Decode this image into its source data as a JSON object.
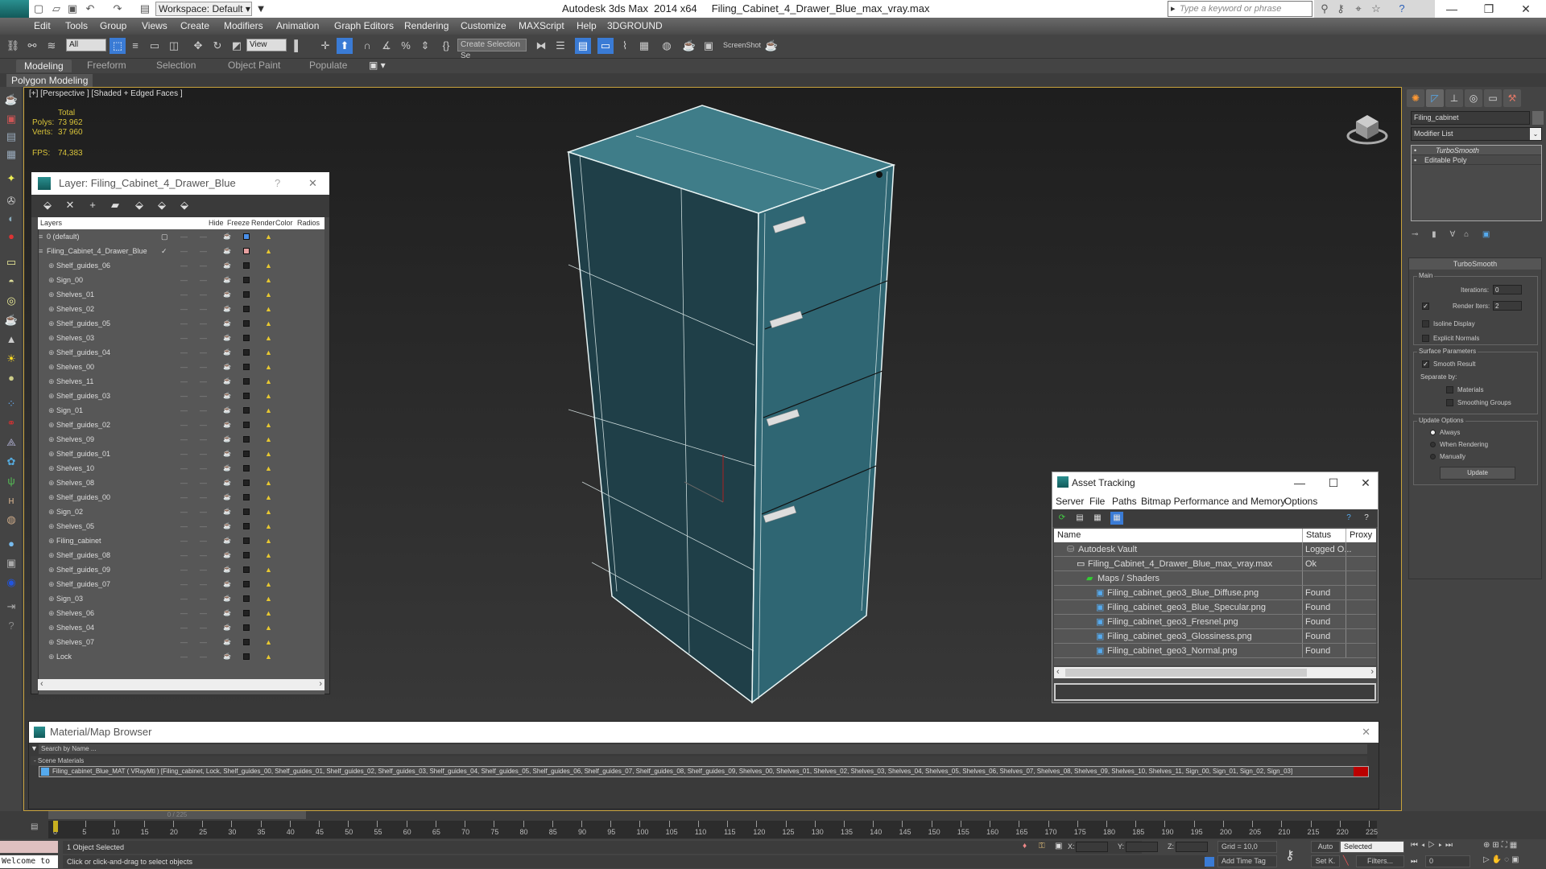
{
  "titlebar": {
    "workspace": "Workspace: Default",
    "app_title": "Autodesk 3ds Max  2014 x64     Filing_Cabinet_4_Drawer_Blue_max_vray.max",
    "search_placeholder": "Type a keyword or phrase"
  },
  "menu": [
    "Edit",
    "Tools",
    "Group",
    "Views",
    "Create",
    "Modifiers",
    "Animation",
    "Graph Editors",
    "Rendering",
    "Customize",
    "MAXScript",
    "Help",
    "3DGROUND"
  ],
  "toolbar": {
    "selection_filter": "All",
    "ref_coord": "View",
    "named_selection": "Create Selection Se",
    "screenshot_label": "ScreenShot"
  },
  "ribbon": {
    "tabs": [
      "Modeling",
      "Freeform",
      "Selection",
      "Object Paint",
      "Populate"
    ],
    "active": "Modeling",
    "sub": "Polygon Modeling"
  },
  "viewport": {
    "label": "[+] [Perspective ] [Shaded + Edged Faces ]",
    "stats": {
      "header": "Total",
      "polys_label": "Polys:",
      "polys": "73 962",
      "verts_label": "Verts:",
      "verts": "37 960",
      "fps_label": "FPS:",
      "fps": "74,383"
    },
    "colors": {
      "cabinet_side": "#1f3f48",
      "cabinet_front": "#2f6673",
      "cabinet_top": "#3f7d89",
      "wire": "#e8f4f4",
      "frame": "#c8a23c"
    }
  },
  "layer_panel": {
    "title": "Layer: Filing_Cabinet_4_Drawer_Blue",
    "columns": [
      "Layers",
      "",
      "Hide",
      "Freeze",
      "Render",
      "Color",
      "Radios"
    ],
    "layers": [
      {
        "name": "0 (default)",
        "type": "layer",
        "color": "#4a8fe8"
      },
      {
        "name": "Filing_Cabinet_4_Drawer_Blue",
        "type": "layer",
        "active": true,
        "color": "#e8a0a0"
      }
    ],
    "objects": [
      "Shelf_guides_06",
      "Sign_00",
      "Shelves_01",
      "Shelves_02",
      "Shelf_guides_05",
      "Shelves_03",
      "Shelf_guides_04",
      "Shelves_00",
      "Shelves_11",
      "Shelf_guides_03",
      "Sign_01",
      "Shelf_guides_02",
      "Shelves_09",
      "Shelf_guides_01",
      "Shelves_10",
      "Shelves_08",
      "Shelf_guides_00",
      "Sign_02",
      "Shelves_05",
      "Filing_cabinet",
      "Shelf_guides_08",
      "Shelf_guides_09",
      "Shelf_guides_07",
      "Sign_03",
      "Shelves_06",
      "Shelves_04",
      "Shelves_07",
      "Lock"
    ]
  },
  "command_panel": {
    "object_name": "Filing_cabinet",
    "modifier_list": "Modifier List",
    "stack": [
      "TurboSmooth",
      "Editable Poly"
    ],
    "turbosmooth": {
      "title": "TurboSmooth",
      "main": "Main",
      "iterations_label": "Iterations:",
      "iterations": "0",
      "render_iters_label": "Render Iters:",
      "render_iters": "2",
      "render_iters_checked": true,
      "isoline": "Isoline Display",
      "explicit": "Explicit Normals",
      "surface": "Surface Parameters",
      "smooth_result": "Smooth Result",
      "separate_by": "Separate by:",
      "materials": "Materials",
      "smoothing_groups": "Smoothing Groups",
      "update_options": "Update Options",
      "always": "Always",
      "when_rendering": "When Rendering",
      "manually": "Manually",
      "update_btn": "Update"
    }
  },
  "asset_tracking": {
    "title": "Asset Tracking",
    "menu": [
      "Server",
      "File",
      "Paths",
      "Bitmap Performance and Memory",
      "Options"
    ],
    "columns": [
      "Name",
      "Status",
      "Proxy"
    ],
    "rows": [
      {
        "name": "Autodesk Vault",
        "status": "Logged O...",
        "indent": 1
      },
      {
        "name": "Filing_Cabinet_4_Drawer_Blue_max_vray.max",
        "status": "Ok",
        "indent": 2
      },
      {
        "name": "Maps / Shaders",
        "status": "",
        "indent": 3
      },
      {
        "name": "Filing_cabinet_geo3_Blue_Diffuse.png",
        "status": "Found",
        "indent": 4
      },
      {
        "name": "Filing_cabinet_geo3_Blue_Specular.png",
        "status": "Found",
        "indent": 4
      },
      {
        "name": "Filing_cabinet_geo3_Fresnel.png",
        "status": "Found",
        "indent": 4
      },
      {
        "name": "Filing_cabinet_geo3_Glossiness.png",
        "status": "Found",
        "indent": 4
      },
      {
        "name": "Filing_cabinet_geo3_Normal.png",
        "status": "Found",
        "indent": 4
      }
    ]
  },
  "material_browser": {
    "title": "Material/Map Browser",
    "search_placeholder": "Search by Name ...",
    "section": "- Scene Materials",
    "entry": "Filing_cabinet_Blue_MAT ( VRayMtl ) [Filing_cabinet, Lock, Shelf_guides_00, Shelf_guides_01, Shelf_guides_02, Shelf_guides_03, Shelf_guides_04, Shelf_guides_05, Shelf_guides_06, Shelf_guides_07, Shelf_guides_08, Shelf_guides_09, Shelves_00, Shelves_01, Shelves_02, Shelves_03, Shelves_04, Shelves_05, Shelves_06, Shelves_07, Shelves_08, Shelves_09, Shelves_10, Shelves_11, Sign_00, Sign_01, Sign_02, Sign_03]"
  },
  "timeline": {
    "frame": "0 / 225",
    "ticks": [
      "0",
      "5",
      "10",
      "15",
      "20",
      "25",
      "30",
      "35",
      "40",
      "45",
      "50",
      "55",
      "60",
      "65",
      "70",
      "75",
      "80",
      "85",
      "90",
      "95",
      "100",
      "105",
      "110",
      "115",
      "120",
      "125",
      "130",
      "135",
      "140",
      "145",
      "150",
      "155",
      "160",
      "165",
      "170",
      "175",
      "180",
      "185",
      "190",
      "195",
      "200",
      "205",
      "210",
      "215",
      "220",
      "225"
    ]
  },
  "status": {
    "maxscript": "Welcome to",
    "selected": "1 Object Selected",
    "prompt": "Click or click-and-drag to select objects",
    "x_label": "X:",
    "y_label": "Y:",
    "z_label": "Z:",
    "grid": "Grid = 10,0",
    "add_time_tag": "Add Time Tag",
    "auto": "Auto",
    "setk": "Set K.",
    "key_filter": "Selected",
    "filters": "Filters...",
    "current_frame": "0"
  }
}
